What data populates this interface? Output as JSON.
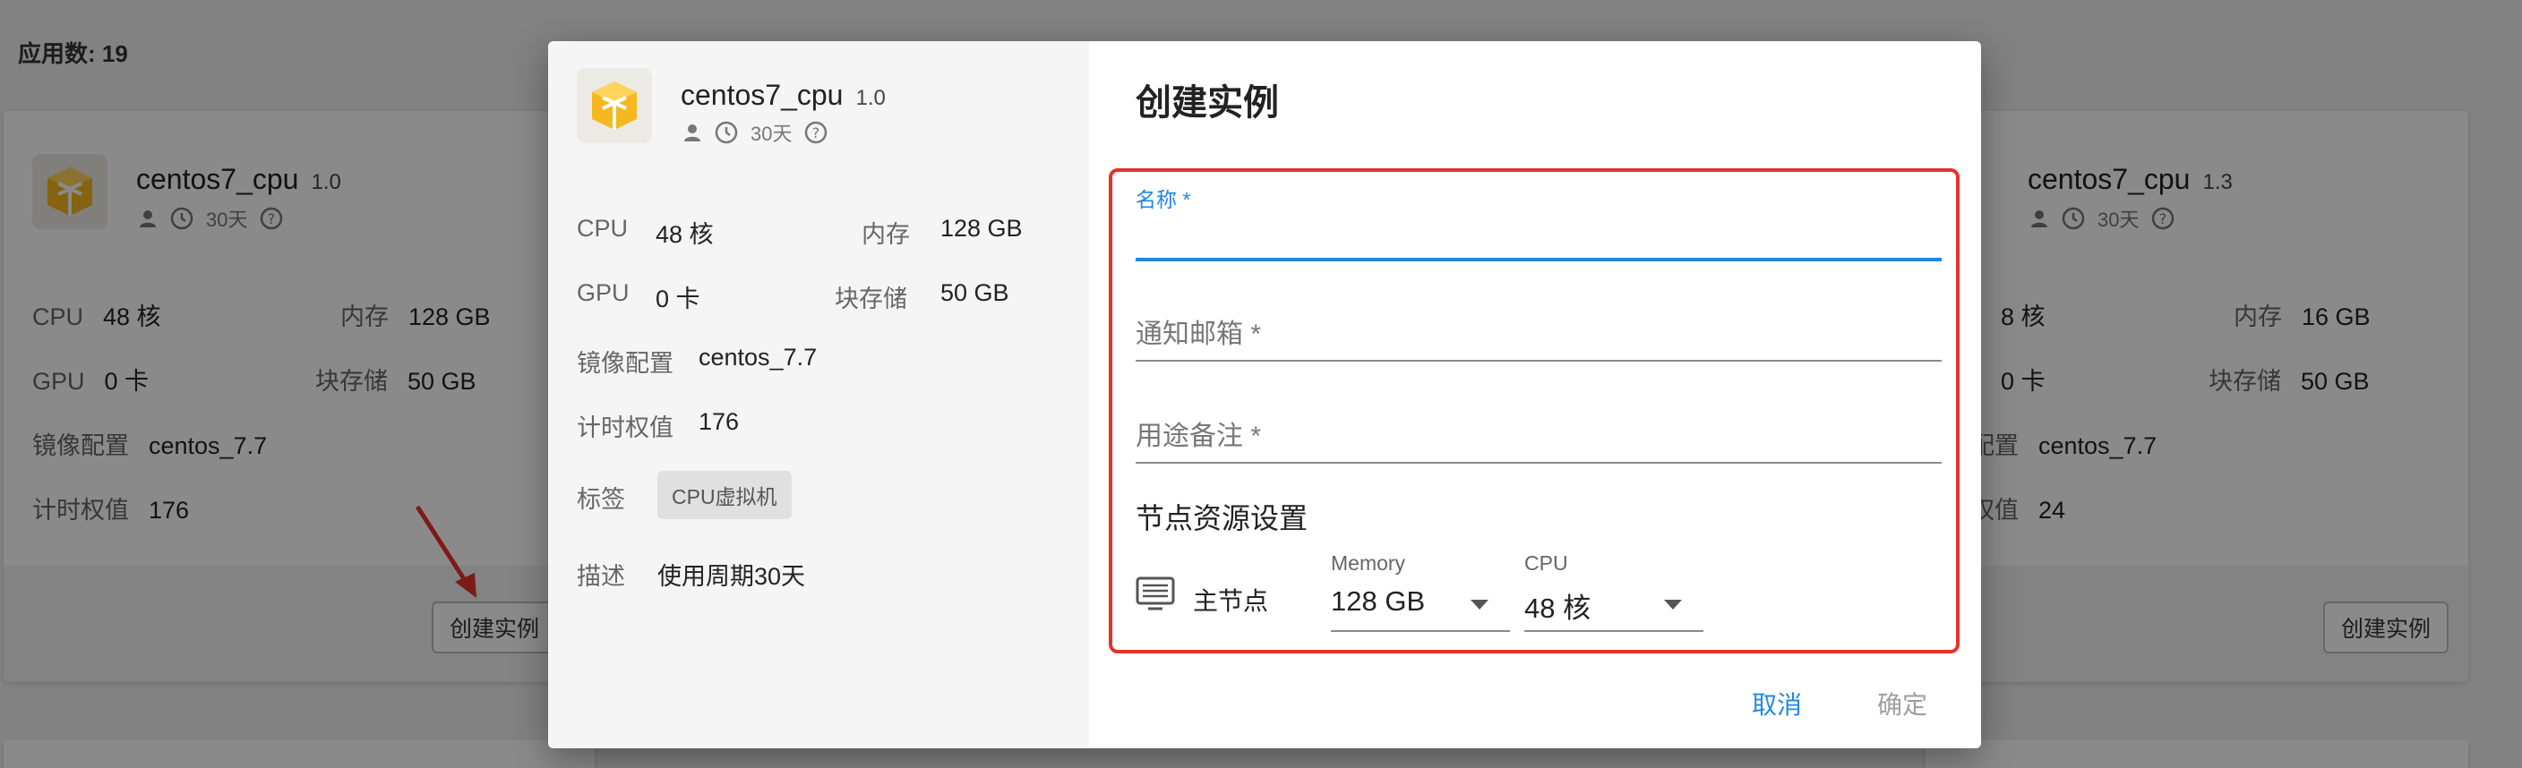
{
  "header": {
    "app_count": "应用数: 19"
  },
  "card_left": {
    "title": "centos7_cpu",
    "version": "1.0",
    "duration": "30天",
    "specs": {
      "cpu_label": "CPU",
      "cpu_value": "48 核",
      "mem_label": "内存",
      "mem_value": "128 GB",
      "gpu_label": "GPU",
      "gpu_value": "0 卡",
      "disk_label": "块存储",
      "disk_value": "50 GB",
      "image_label": "镜像配置",
      "image_value": "centos_7.7",
      "weight_label": "计时权值",
      "weight_value": "176"
    },
    "create_button": "创建实例"
  },
  "card_right": {
    "title": "centos7_cpu",
    "version": "1.3",
    "duration": "30天",
    "specs": {
      "cpu_value": "8 核",
      "mem_label": "内存",
      "mem_value": "16 GB",
      "gpu_value": "0 卡",
      "disk_label": "块存储",
      "disk_value": "50 GB",
      "image_label_partial": "配置",
      "image_value": "centos_7.7",
      "weight_label_partial": "权值",
      "weight_value": "24"
    },
    "create_button": "创建实例"
  },
  "dialog": {
    "left": {
      "title": "centos7_cpu",
      "version": "1.0",
      "duration": "30天",
      "cpu_label": "CPU",
      "cpu_value": "48 核",
      "mem_label": "内存",
      "mem_value": "128 GB",
      "gpu_label": "GPU",
      "gpu_value": "0 卡",
      "disk_label": "块存储",
      "disk_value": "50 GB",
      "image_label": "镜像配置",
      "image_value": "centos_7.7",
      "weight_label": "计时权值",
      "weight_value": "176",
      "tag_label": "标签",
      "tag_value": "CPU虚拟机",
      "desc_label": "描述",
      "desc_value": "使用周期30天"
    },
    "right": {
      "title": "创建实例",
      "name_label": "名称 *",
      "name_value": "",
      "email_placeholder": "通知邮箱 *",
      "purpose_placeholder": "用途备注 *",
      "section_title": "节点资源设置",
      "node_label": "主节点",
      "memory_label": "Memory",
      "memory_value": "128 GB",
      "cpu_label": "CPU",
      "cpu_value": "48 核",
      "cancel": "取消",
      "confirm": "确定"
    }
  },
  "colors": {
    "primary": "#1e88e5",
    "highlight": "#e5322d",
    "disabled": "#9e9e9e"
  }
}
